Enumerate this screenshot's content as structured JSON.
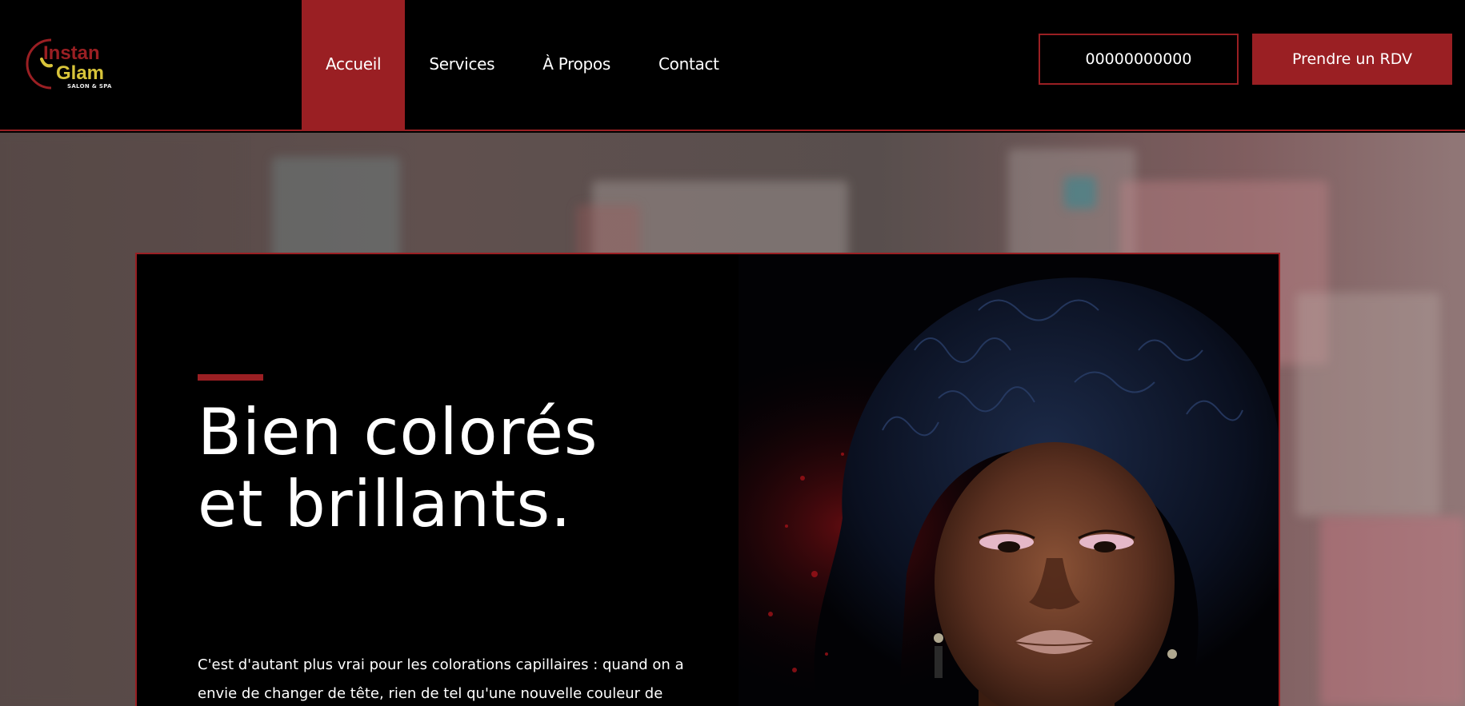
{
  "logo": {
    "brand_top": "Instan",
    "brand_bottom": "Glam",
    "tagline": "SALON & SPA"
  },
  "nav": {
    "items": [
      {
        "label": "Accueil",
        "active": true
      },
      {
        "label": "Services",
        "active": false
      },
      {
        "label": "À Propos",
        "active": false
      },
      {
        "label": "Contact",
        "active": false
      }
    ]
  },
  "header": {
    "phone": "00000000000",
    "cta_label": "Prendre un RDV"
  },
  "hero": {
    "title_line1": "Bien colorés",
    "title_line2": "et brillants.",
    "body": "C'est d'autant plus vrai pour les colorations capillaires : quand on a envie de changer de tête, rien de tel qu'une nouvelle couleur de cheveux !"
  },
  "colors": {
    "accent": "#9a1f23",
    "logo_yellow": "#d8c43a",
    "background": "#000000",
    "text": "#ffffff"
  }
}
